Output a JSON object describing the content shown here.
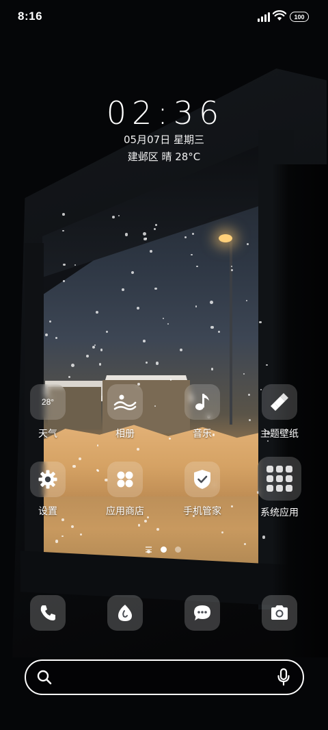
{
  "status_bar": {
    "time": "8:16",
    "battery": "100",
    "icons": [
      "signal-icon",
      "wifi-icon",
      "battery-icon"
    ]
  },
  "lockscreen": {
    "clock": "02:36",
    "date": "05月07日 星期三",
    "weather": "建邺区 晴 28°C"
  },
  "apps": [
    {
      "label": "天气",
      "icon": "weather-icon",
      "tile_text": "28°"
    },
    {
      "label": "相册",
      "icon": "gallery-icon"
    },
    {
      "label": "音乐",
      "icon": "music-note-icon"
    },
    {
      "label": "主题壁纸",
      "icon": "paint-brush-icon"
    },
    {
      "label": "设置",
      "icon": "gear-icon"
    },
    {
      "label": "应用商店",
      "icon": "app-store-icon"
    },
    {
      "label": "手机管家",
      "icon": "shield-check-icon"
    },
    {
      "label": "系统应用",
      "icon": "folder-grid-icon"
    }
  ],
  "page_indicator": {
    "pages": 2,
    "active": 1
  },
  "dock": [
    {
      "icon": "phone-icon"
    },
    {
      "icon": "browser-icon"
    },
    {
      "icon": "messages-icon"
    },
    {
      "icon": "camera-icon"
    }
  ],
  "search_bar": {
    "icons": [
      "search-icon",
      "microphone-icon"
    ]
  },
  "colors": {
    "tile_bg": "rgba(255,255,255,0.18)",
    "text": "#ffffff",
    "lamp": "#ffd07a",
    "snow_ground": "#d5a264"
  }
}
